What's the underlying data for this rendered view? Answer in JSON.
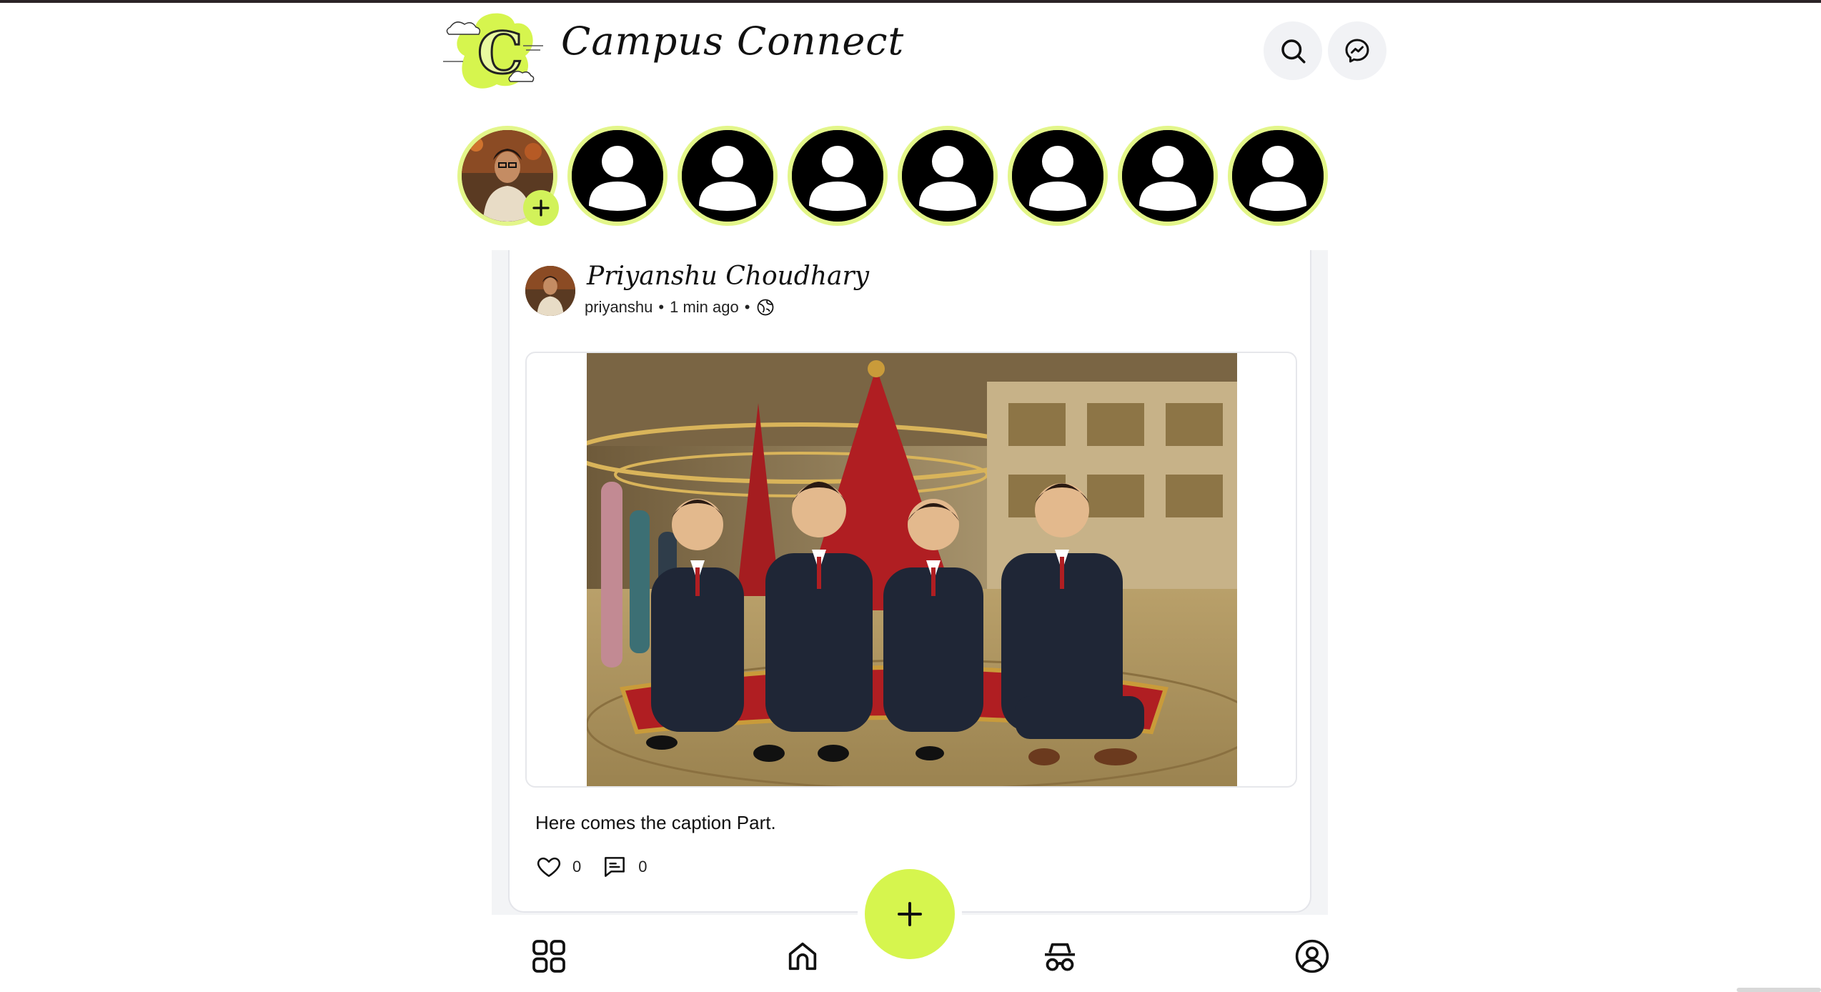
{
  "app": {
    "brand_name": "Campus Connect",
    "logo_letter": "C",
    "accent_color": "#d6f54e"
  },
  "header": {
    "search_icon": "search-icon",
    "messenger_icon": "messenger-icon"
  },
  "stories": {
    "own_story_add_icon": "plus-icon",
    "placeholder_icon": "user-silhouette-icon",
    "count": 8
  },
  "post": {
    "author_name": "Priyanshu Choudhary",
    "username": "priyanshu",
    "time_ago": "1 min ago",
    "visibility_icon": "globe-icon",
    "caption": "Here comes the caption Part.",
    "likes": "0",
    "comments": "0"
  },
  "bottom_nav": {
    "items": [
      "grid-icon",
      "home-icon",
      "incognito-icon",
      "profile-icon"
    ],
    "fab_icon": "plus-icon"
  }
}
